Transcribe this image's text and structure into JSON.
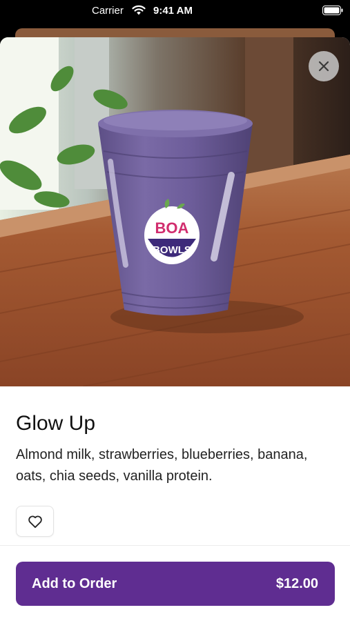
{
  "status_bar": {
    "carrier": "Carrier",
    "time": "9:41 AM"
  },
  "product": {
    "image_label_top": "BOA",
    "image_label_bottom": "BOWLS",
    "title": "Glow Up",
    "description": "Almond milk, strawberries, blueberries, banana, oats, chia seeds, vanilla protein."
  },
  "actions": {
    "close_icon": "close-icon",
    "favorite_icon": "heart-icon",
    "add_to_order_label": "Add to Order",
    "price": "$12.00"
  },
  "colors": {
    "accent": "#5f2d91",
    "smoothie": "#6f5f9c",
    "table": "#a2542e"
  }
}
